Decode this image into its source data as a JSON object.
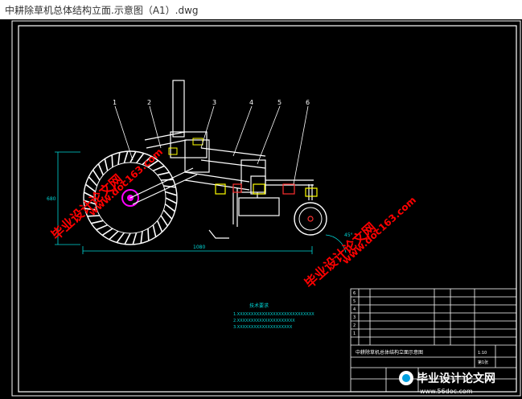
{
  "window": {
    "title": "中耕除草机总体结构立面.示意图（A1）.dwg"
  },
  "colors": {
    "frame": "#ffffff",
    "dimension": "#00d8d8",
    "part_line": "#ffffff",
    "wheel": "#ffffff",
    "hub": "#ff00ff",
    "component_yellow": "#ffff00",
    "component_red": "#ff3030",
    "watermark": "#ff0000"
  },
  "callouts": [
    "1",
    "2",
    "3",
    "4",
    "5",
    "6"
  ],
  "dimensions": {
    "horizontal": "1080",
    "vertical": "680",
    "angle": "45°"
  },
  "notes": {
    "title": "技术要求",
    "lines": [
      "1.XXXXXXXXXXXXXXXXXXXXXXXXXXXX",
      "2.XXXXXXXXXXXXXXXXXXXXX",
      "3.XXXXXXXXXXXXXXXXXXXX"
    ]
  },
  "title_block": {
    "rows": [
      "6",
      "5",
      "4",
      "3",
      "2",
      "1"
    ],
    "drawing_name": "中耕除草机总体结构立面示意图",
    "scale": "1:10",
    "sheet": "第1张"
  },
  "watermarks": {
    "left": "毕业设计论文网",
    "left_url": "www.doc163.com",
    "right": "毕业设计论文网",
    "right_url": "www.doc163.com",
    "logo_text": "毕业设计论文网",
    "logo_url": "www.56doc.com"
  }
}
